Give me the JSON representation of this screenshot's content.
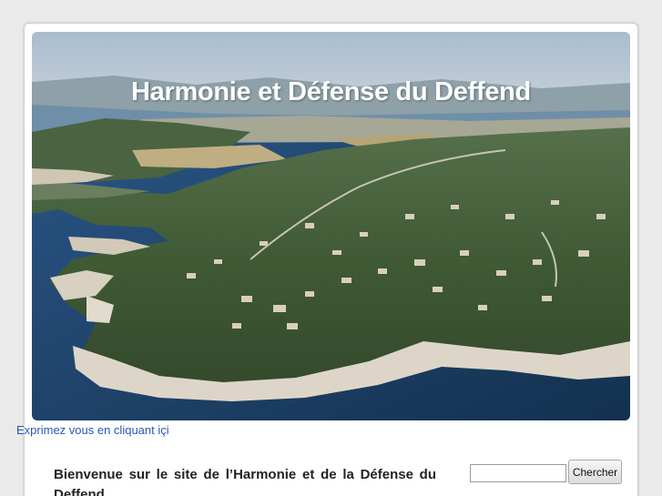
{
  "header": {
    "site_title": "Harmonie et Défense du Deffend"
  },
  "links": {
    "express": "Exprimez vous en cliquant içi"
  },
  "content": {
    "welcome_heading": "Bienvenue sur le site de l’Harmonie et de la Défense du Deffend"
  },
  "search": {
    "placeholder": "",
    "button_label": "Chercher"
  },
  "colors": {
    "page_background": "#eaeaea",
    "card_background": "#ffffff",
    "link": "#2a55b8",
    "heading_text": "#222222",
    "sea": "#1d3f6e",
    "vegetation": "#3f5a34",
    "rock": "#ddd6c8",
    "sky": "#b8c8d8"
  }
}
